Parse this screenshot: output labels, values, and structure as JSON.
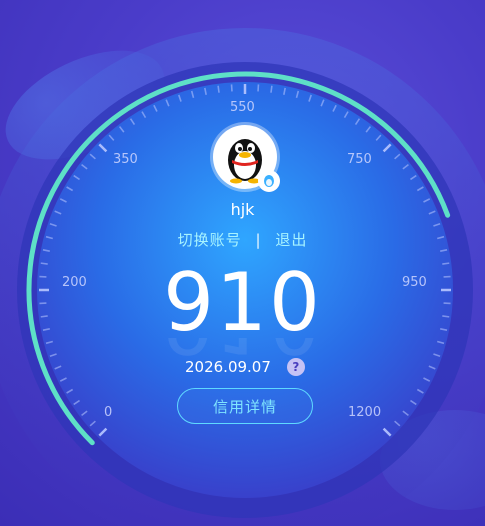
{
  "user": {
    "name": "hjk"
  },
  "account": {
    "switch_label": "切换账号",
    "separator": "|",
    "logout_label": "退出"
  },
  "credit": {
    "score": "910",
    "date": "2026.09.07",
    "help_symbol": "?",
    "details_label": "信用详情",
    "scale": {
      "min": 0,
      "max": 1200
    }
  },
  "gauge": {
    "labels": [
      "0",
      "200",
      "350",
      "550",
      "750",
      "950",
      "1200"
    ],
    "progress_color": "#5ee0c7"
  }
}
